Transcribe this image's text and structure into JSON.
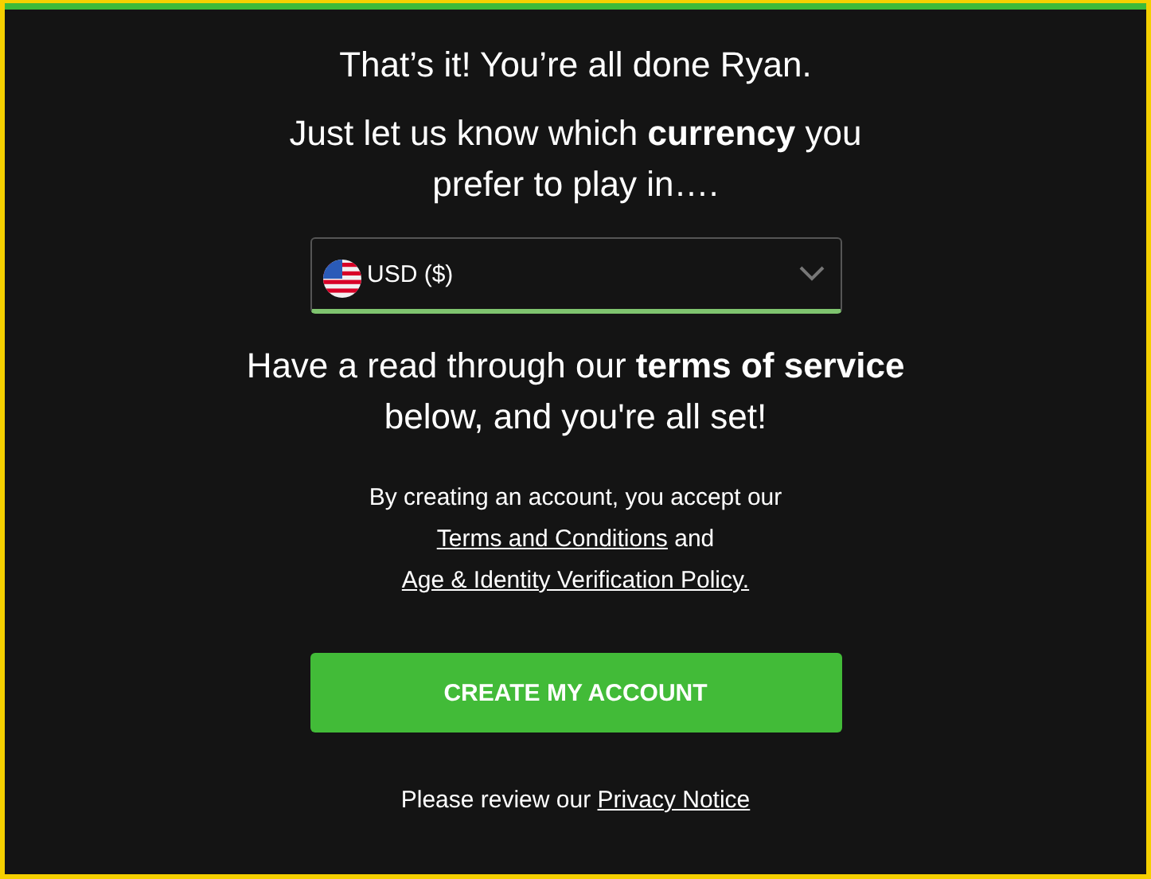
{
  "heading": "That’s it! You’re all done Ryan.",
  "currency_prompt": "Just let us know which **currency** you prefer to play in….",
  "currency_select": {
    "value": "USD ($)"
  },
  "terms_heading": "Have a read through our **terms of service** below, and you're all set!",
  "terms_note": {
    "before": "By creating an account, you accept our",
    "link_1": "Terms and Conditions",
    "middle": "and",
    "link_2": "Age & Identity Verification Policy."
  },
  "create_button": "CREATE MY ACCOUNT",
  "privacy_note": {
    "before": "Please review our",
    "link": "Privacy Notice"
  }
}
